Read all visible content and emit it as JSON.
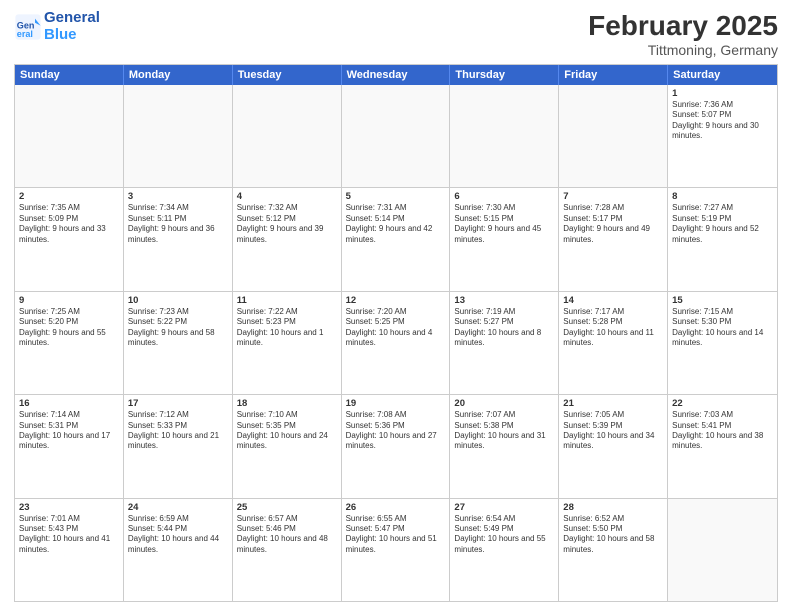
{
  "header": {
    "logo_line1": "General",
    "logo_line2": "Blue",
    "month_year": "February 2025",
    "location": "Tittmoning, Germany"
  },
  "days_of_week": [
    "Sunday",
    "Monday",
    "Tuesday",
    "Wednesday",
    "Thursday",
    "Friday",
    "Saturday"
  ],
  "weeks": [
    [
      {
        "day": "",
        "empty": true
      },
      {
        "day": "",
        "empty": true
      },
      {
        "day": "",
        "empty": true
      },
      {
        "day": "",
        "empty": true
      },
      {
        "day": "",
        "empty": true
      },
      {
        "day": "",
        "empty": true
      },
      {
        "day": "1",
        "sunrise": "7:36 AM",
        "sunset": "5:07 PM",
        "daylight": "9 hours and 30 minutes."
      }
    ],
    [
      {
        "day": "2",
        "sunrise": "7:35 AM",
        "sunset": "5:09 PM",
        "daylight": "9 hours and 33 minutes."
      },
      {
        "day": "3",
        "sunrise": "7:34 AM",
        "sunset": "5:11 PM",
        "daylight": "9 hours and 36 minutes."
      },
      {
        "day": "4",
        "sunrise": "7:32 AM",
        "sunset": "5:12 PM",
        "daylight": "9 hours and 39 minutes."
      },
      {
        "day": "5",
        "sunrise": "7:31 AM",
        "sunset": "5:14 PM",
        "daylight": "9 hours and 42 minutes."
      },
      {
        "day": "6",
        "sunrise": "7:30 AM",
        "sunset": "5:15 PM",
        "daylight": "9 hours and 45 minutes."
      },
      {
        "day": "7",
        "sunrise": "7:28 AM",
        "sunset": "5:17 PM",
        "daylight": "9 hours and 49 minutes."
      },
      {
        "day": "8",
        "sunrise": "7:27 AM",
        "sunset": "5:19 PM",
        "daylight": "9 hours and 52 minutes."
      }
    ],
    [
      {
        "day": "9",
        "sunrise": "7:25 AM",
        "sunset": "5:20 PM",
        "daylight": "9 hours and 55 minutes."
      },
      {
        "day": "10",
        "sunrise": "7:23 AM",
        "sunset": "5:22 PM",
        "daylight": "9 hours and 58 minutes."
      },
      {
        "day": "11",
        "sunrise": "7:22 AM",
        "sunset": "5:23 PM",
        "daylight": "10 hours and 1 minute."
      },
      {
        "day": "12",
        "sunrise": "7:20 AM",
        "sunset": "5:25 PM",
        "daylight": "10 hours and 4 minutes."
      },
      {
        "day": "13",
        "sunrise": "7:19 AM",
        "sunset": "5:27 PM",
        "daylight": "10 hours and 8 minutes."
      },
      {
        "day": "14",
        "sunrise": "7:17 AM",
        "sunset": "5:28 PM",
        "daylight": "10 hours and 11 minutes."
      },
      {
        "day": "15",
        "sunrise": "7:15 AM",
        "sunset": "5:30 PM",
        "daylight": "10 hours and 14 minutes."
      }
    ],
    [
      {
        "day": "16",
        "sunrise": "7:14 AM",
        "sunset": "5:31 PM",
        "daylight": "10 hours and 17 minutes."
      },
      {
        "day": "17",
        "sunrise": "7:12 AM",
        "sunset": "5:33 PM",
        "daylight": "10 hours and 21 minutes."
      },
      {
        "day": "18",
        "sunrise": "7:10 AM",
        "sunset": "5:35 PM",
        "daylight": "10 hours and 24 minutes."
      },
      {
        "day": "19",
        "sunrise": "7:08 AM",
        "sunset": "5:36 PM",
        "daylight": "10 hours and 27 minutes."
      },
      {
        "day": "20",
        "sunrise": "7:07 AM",
        "sunset": "5:38 PM",
        "daylight": "10 hours and 31 minutes."
      },
      {
        "day": "21",
        "sunrise": "7:05 AM",
        "sunset": "5:39 PM",
        "daylight": "10 hours and 34 minutes."
      },
      {
        "day": "22",
        "sunrise": "7:03 AM",
        "sunset": "5:41 PM",
        "daylight": "10 hours and 38 minutes."
      }
    ],
    [
      {
        "day": "23",
        "sunrise": "7:01 AM",
        "sunset": "5:43 PM",
        "daylight": "10 hours and 41 minutes."
      },
      {
        "day": "24",
        "sunrise": "6:59 AM",
        "sunset": "5:44 PM",
        "daylight": "10 hours and 44 minutes."
      },
      {
        "day": "25",
        "sunrise": "6:57 AM",
        "sunset": "5:46 PM",
        "daylight": "10 hours and 48 minutes."
      },
      {
        "day": "26",
        "sunrise": "6:55 AM",
        "sunset": "5:47 PM",
        "daylight": "10 hours and 51 minutes."
      },
      {
        "day": "27",
        "sunrise": "6:54 AM",
        "sunset": "5:49 PM",
        "daylight": "10 hours and 55 minutes."
      },
      {
        "day": "28",
        "sunrise": "6:52 AM",
        "sunset": "5:50 PM",
        "daylight": "10 hours and 58 minutes."
      },
      {
        "day": "",
        "empty": true
      }
    ]
  ]
}
